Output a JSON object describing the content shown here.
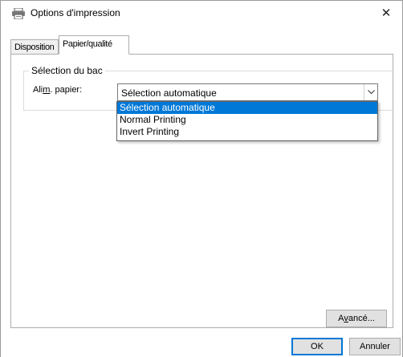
{
  "window": {
    "title": "Options d'impression",
    "icon": "printer-icon"
  },
  "tabs": [
    {
      "label": "Disposition",
      "active": false
    },
    {
      "label": "Papier/qualité",
      "active": true
    }
  ],
  "tray_group": {
    "label": "Sélection du bac",
    "field_label_prefix": "Ali",
    "field_label_accel": "m",
    "field_label_suffix": ". papier:",
    "selected": "Sélection automatique",
    "options": [
      {
        "label": "Sélection automatique",
        "highlighted": true
      },
      {
        "label": "Normal Printing",
        "highlighted": false
      },
      {
        "label": "Invert Printing",
        "highlighted": false
      }
    ]
  },
  "buttons": {
    "advanced_prefix": "A",
    "advanced_accel": "v",
    "advanced_suffix": "ancé...",
    "ok": "OK",
    "cancel": "Annuler"
  },
  "colors": {
    "selection": "#0078d7",
    "button_face": "#e1e1e1",
    "border": "#adadad"
  }
}
